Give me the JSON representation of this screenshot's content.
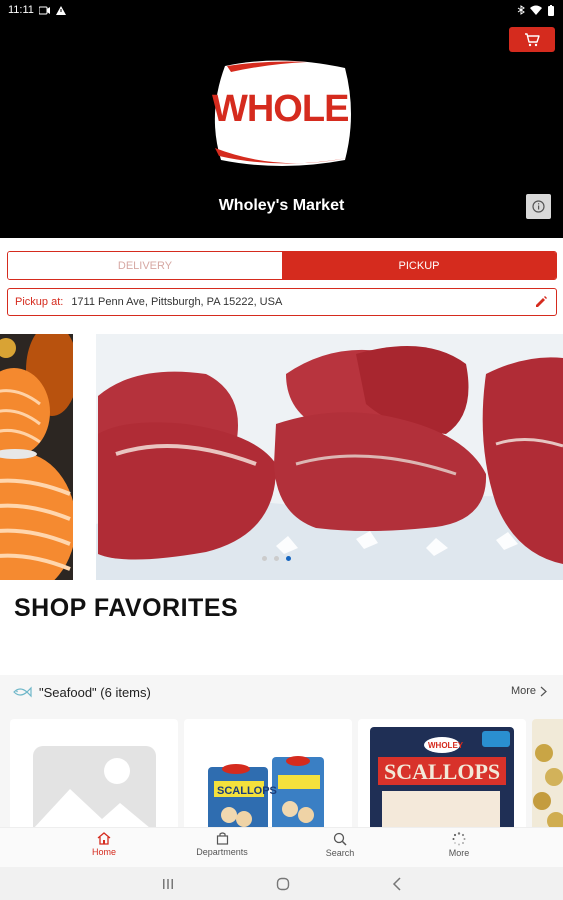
{
  "status_bar": {
    "time": "11:11"
  },
  "header": {
    "logo_text": "WHOLE",
    "store_name": "Wholey's Market"
  },
  "fulfillment": {
    "delivery_label": "DELIVERY",
    "pickup_label": "PICKUP",
    "selected": "PICKUP"
  },
  "pickup": {
    "label": "Pickup at:",
    "address": "1711 Penn Ave, Pittsburgh, PA 15222, USA"
  },
  "carousel": {
    "slide_count": 3,
    "active_index": 2
  },
  "favorites": {
    "title": "SHOP FAVORITES"
  },
  "category": {
    "label": "\"Seafood\" (6 items)",
    "more_label": "More"
  },
  "products": [
    {
      "image": "placeholder-image"
    },
    {
      "image": "scallops-bags",
      "package_text": "SCALLOPS"
    },
    {
      "image": "scallops-package",
      "brand": "WHOLEY",
      "package_text": "SCALLOPS"
    },
    {
      "image": "partial-product"
    }
  ],
  "bottom_nav": [
    {
      "label": "Home",
      "icon": "home-icon",
      "active": true
    },
    {
      "label": "Departments",
      "icon": "bag-icon",
      "active": false
    },
    {
      "label": "Search",
      "icon": "search-icon",
      "active": false
    },
    {
      "label": "More",
      "icon": "loading-icon",
      "active": false
    }
  ],
  "colors": {
    "brand_red": "#d52b1e",
    "header_bg": "#000000",
    "active_dot": "#1565c0"
  }
}
